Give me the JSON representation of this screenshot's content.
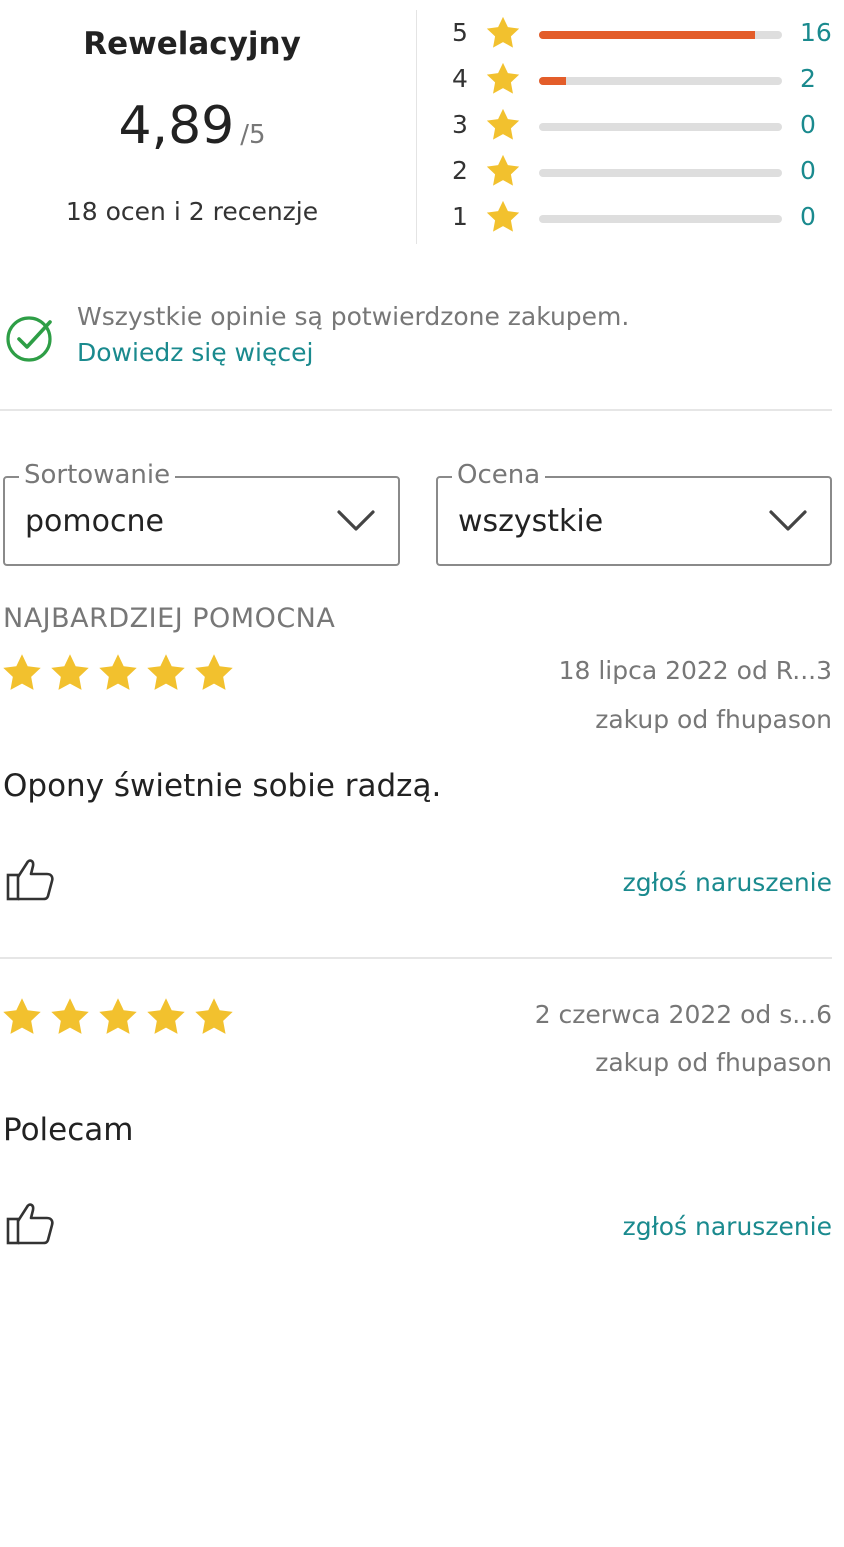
{
  "summary": {
    "verdict": "Rewelacyjny",
    "score": "4,89",
    "out_of": "/5",
    "counts_text": "18 ocen i 2 recenzje",
    "distribution": [
      {
        "stars": "5",
        "count": "16",
        "fraction": 0.89
      },
      {
        "stars": "4",
        "count": "2",
        "fraction": 0.11
      },
      {
        "stars": "3",
        "count": "0",
        "fraction": 0
      },
      {
        "stars": "2",
        "count": "0",
        "fraction": 0
      },
      {
        "stars": "1",
        "count": "0",
        "fraction": 0
      }
    ]
  },
  "verification": {
    "text": "Wszystkie opinie są potwierdzone zakupem.",
    "link": "Dowiedz się więcej"
  },
  "filters": {
    "sort": {
      "label": "Sortowanie",
      "value": "pomocne"
    },
    "rating": {
      "label": "Ocena",
      "value": "wszystkie"
    }
  },
  "reviews_section_label": "NAJBARDZIEJ POMOCNA",
  "reviews": [
    {
      "rating": 5,
      "date_author": "18 lipca 2022 od R...3",
      "purchase": "zakup od fhupason",
      "text": "Opony świetnie sobie radzą.",
      "report": "zgłoś naruszenie"
    },
    {
      "rating": 5,
      "date_author": "2 czerwca 2022 od s...6",
      "purchase": "zakup od fhupason",
      "text": "Polecam",
      "report": "zgłoś naruszenie"
    }
  ],
  "colors": {
    "star": "#f2c12e",
    "bar_fill": "#e35d2a",
    "bar_track": "#dedede",
    "link": "#1a8a8e",
    "check": "#2e9e46"
  }
}
